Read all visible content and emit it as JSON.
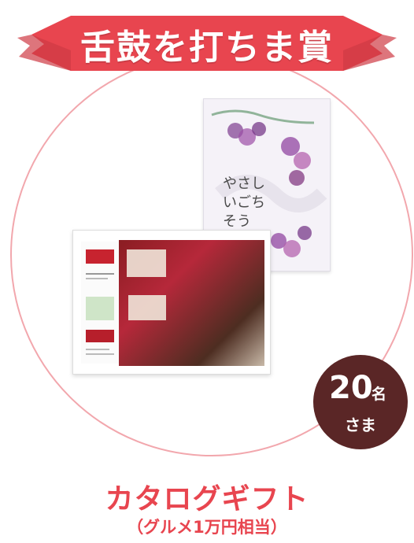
{
  "banner": {
    "title": "舌鼓を打ちま賞"
  },
  "catalog": {
    "cover_title": "やさしいごちそう"
  },
  "badge": {
    "count": "20",
    "unit": "名",
    "honorific": "さま"
  },
  "prize": {
    "name": "カタログギフト",
    "note": "（グルメ1万円相当）"
  },
  "colors": {
    "ribbon": "#e8454f",
    "badge": "#5a2626",
    "text_accent": "#e8454f",
    "circle_border": "#f2a7ad"
  }
}
